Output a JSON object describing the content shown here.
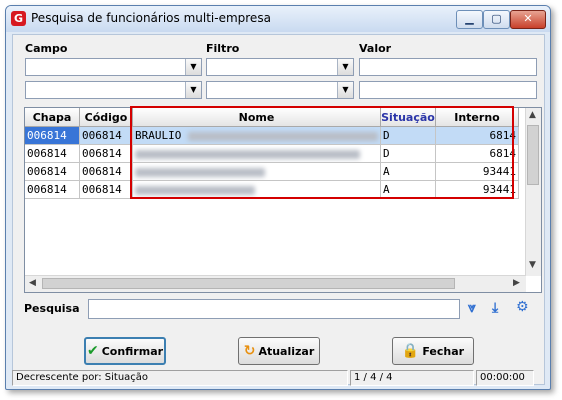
{
  "window": {
    "title": "Pesquisa de funcionários multi-empresa",
    "app_icon": "G",
    "min": "▁",
    "max": "▢",
    "close": "✕"
  },
  "filters": {
    "campo_label": "Campo",
    "filtro_label": "Filtro",
    "valor_label": "Valor"
  },
  "grid": {
    "columns": [
      "Chapa",
      "Código",
      "Nome",
      "Situação",
      "Interno"
    ],
    "sorted_column": "Situação",
    "rows": [
      {
        "chapa": "006814",
        "codigo": "006814",
        "nome": "BRAULIO",
        "situacao": "D",
        "interno": "6814"
      },
      {
        "chapa": "006814",
        "codigo": "006814",
        "nome": "",
        "situacao": "D",
        "interno": "6814"
      },
      {
        "chapa": "006814",
        "codigo": "006814",
        "nome": "",
        "situacao": "A",
        "interno": "93441"
      },
      {
        "chapa": "006814",
        "codigo": "006814",
        "nome": "",
        "situacao": "A",
        "interno": "93441"
      }
    ]
  },
  "search": {
    "label": "Pesquisa",
    "value": ""
  },
  "buttons": {
    "confirm": "Confirmar",
    "refresh": "Atualizar",
    "close": "Fechar"
  },
  "status": {
    "sort_text": "Decrescente por: Situação",
    "position": "1 / 4 / 4",
    "time": "00:00:00"
  },
  "colors": {
    "selection": "#3875d7",
    "highlight_box": "#d40000",
    "accent": "#2f6fd1"
  }
}
